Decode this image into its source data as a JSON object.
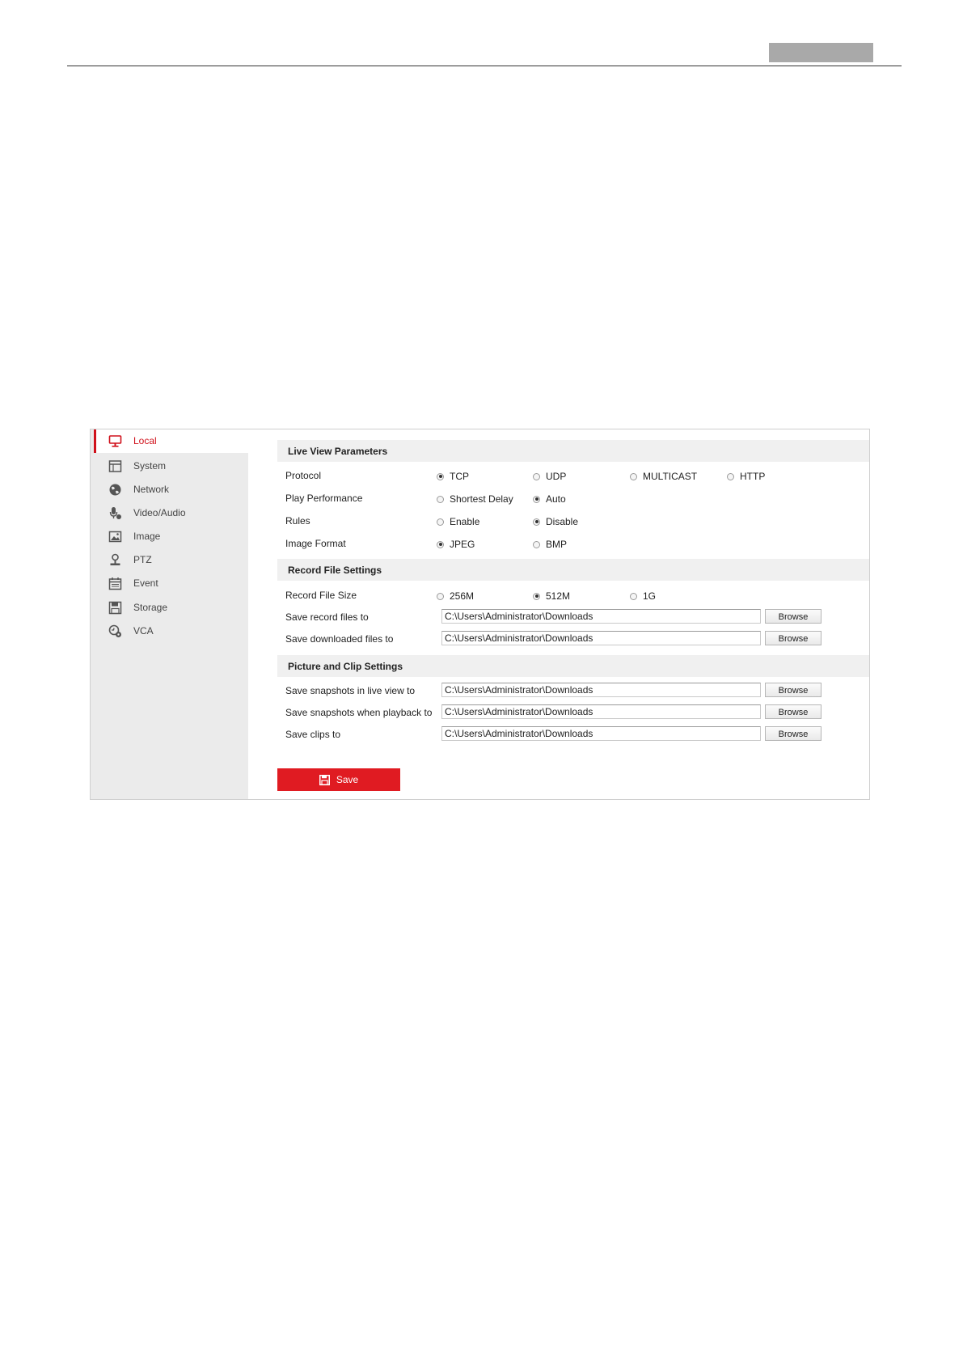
{
  "sidebar": {
    "items": [
      {
        "label": "Local",
        "icon": "monitor-icon",
        "active": true
      },
      {
        "label": "System",
        "icon": "system-window-icon"
      },
      {
        "label": "Network",
        "icon": "globe-icon"
      },
      {
        "label": "Video/Audio",
        "icon": "microphone-icon"
      },
      {
        "label": "Image",
        "icon": "picture-icon"
      },
      {
        "label": "PTZ",
        "icon": "ptz-user-icon"
      },
      {
        "label": "Event",
        "icon": "calendar-icon"
      },
      {
        "label": "Storage",
        "icon": "floppy-disk-icon"
      },
      {
        "label": "VCA",
        "icon": "vca-gear-icon"
      }
    ]
  },
  "live_view": {
    "title": "Live View Parameters",
    "protocol": {
      "label": "Protocol",
      "options": [
        "TCP",
        "UDP",
        "MULTICAST",
        "HTTP"
      ],
      "selected": "TCP"
    },
    "play_performance": {
      "label": "Play Performance",
      "options": [
        "Shortest Delay",
        "Auto"
      ],
      "selected": "Auto"
    },
    "rules": {
      "label": "Rules",
      "options": [
        "Enable",
        "Disable"
      ],
      "selected": "Disable"
    },
    "image_format": {
      "label": "Image Format",
      "options": [
        "JPEG",
        "BMP"
      ],
      "selected": "JPEG"
    }
  },
  "record_file": {
    "title": "Record File Settings",
    "size": {
      "label": "Record File Size",
      "options": [
        "256M",
        "512M",
        "1G"
      ],
      "selected": "512M"
    },
    "save_record": {
      "label": "Save record files to",
      "value": "C:\\Users\\Administrator\\Downloads"
    },
    "save_downloaded": {
      "label": "Save downloaded files to",
      "value": "C:\\Users\\Administrator\\Downloads"
    }
  },
  "picture_clip": {
    "title": "Picture and Clip Settings",
    "snap_live": {
      "label": "Save snapshots in live view to",
      "value": "C:\\Users\\Administrator\\Downloads"
    },
    "snap_playback": {
      "label": "Save snapshots when playback to",
      "value": "C:\\Users\\Administrator\\Downloads"
    },
    "clips": {
      "label": "Save clips to",
      "value": "C:\\Users\\Administrator\\Downloads"
    }
  },
  "buttons": {
    "browse": "Browse",
    "save": "Save"
  },
  "colors": {
    "accent": "#e01b22",
    "sidebar_bg": "#ebebeb",
    "section_bg": "#f0f0f0"
  }
}
